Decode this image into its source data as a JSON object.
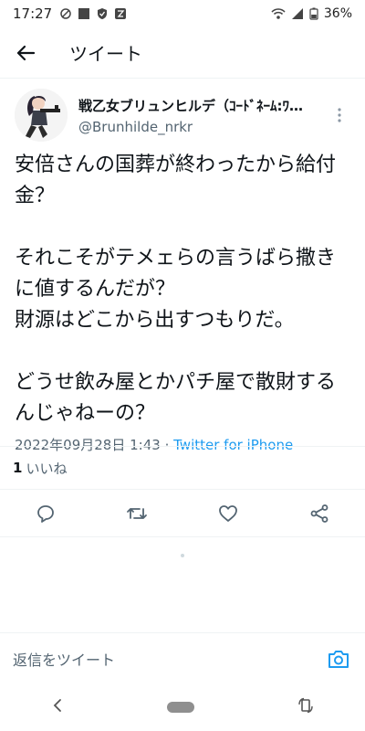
{
  "status": {
    "time": "17:27",
    "battery": "36%"
  },
  "header": {
    "title": "ツイート"
  },
  "tweet": {
    "display_name": "戦乙女ブリュンヒルデ（ｺｰﾄﾞﾈｰﾑ:ﾜ…",
    "handle": "@Brunhilde_nrkr",
    "text": "安倍さんの国葬が終わったから給付金？\n\nそれこそがテメェらの言うばら撒きに値するんだが？\n財源はどこから出すつもりだ。\n\nどうせ飲み屋とかパチ屋で散財するんじゃねーの？",
    "timestamp": "2022年09月28日 1:43",
    "separator": " · ",
    "source": "Twitter for iPhone",
    "like_count": "1",
    "like_label": "いいね"
  },
  "reply": {
    "placeholder": "返信をツイート"
  },
  "colors": {
    "accent": "#1d9bf0",
    "text": "#0f1419",
    "muted": "#536471",
    "divider": "#eff3f4"
  },
  "icons": {
    "back": "arrow-left-icon",
    "more": "more-vertical-icon",
    "reply": "comment-icon",
    "retweet": "retweet-icon",
    "like": "heart-icon",
    "share": "share-icon",
    "camera": "camera-icon"
  }
}
